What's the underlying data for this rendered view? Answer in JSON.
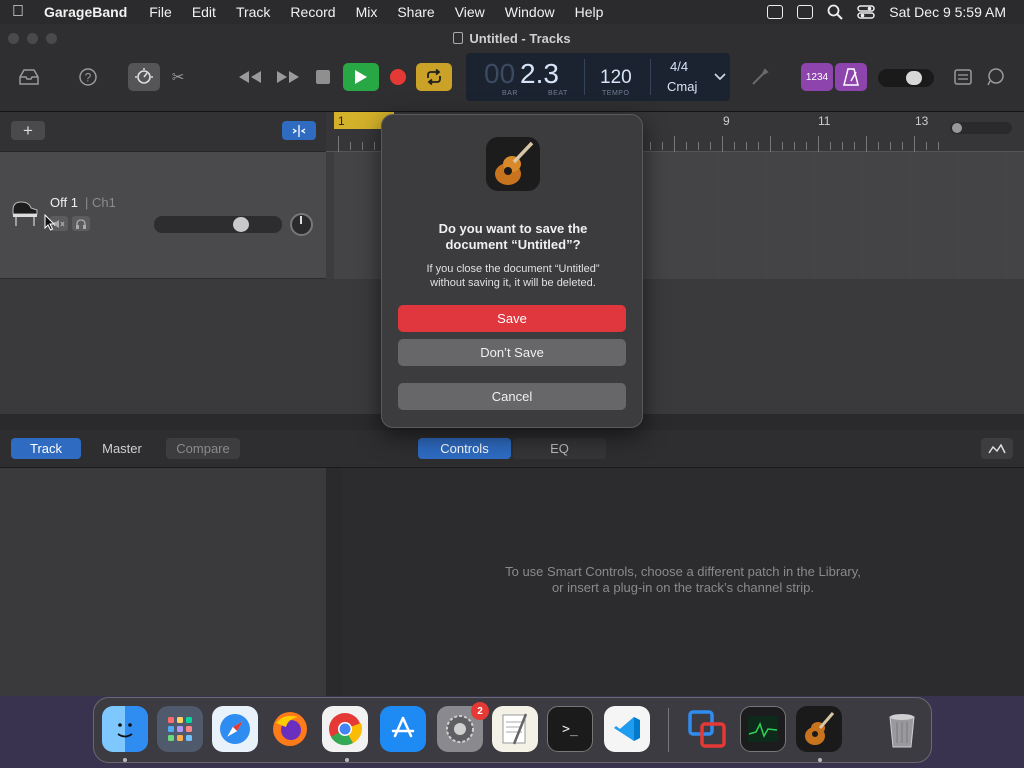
{
  "menubar": {
    "app_name": "GarageBand",
    "items": [
      "File",
      "Edit",
      "Track",
      "Record",
      "Mix",
      "Share",
      "View",
      "Window",
      "Help"
    ],
    "datetime": "Sat Dec 9  5:59 AM"
  },
  "window": {
    "title": "Untitled - Tracks"
  },
  "lcd": {
    "bar_value": "00",
    "beat_value": "2.3",
    "bar_label": "BAR",
    "beat_label": "BEAT",
    "tempo_value": "120",
    "tempo_label": "TEMPO",
    "time_signature": "4/4",
    "key": "Cmaj"
  },
  "toolbar": {
    "tuner_button": "1234"
  },
  "track": {
    "name": "Off 1",
    "channel": "| Ch1",
    "volume_level": 0.72
  },
  "ruler": {
    "marks": [
      "1",
      "9",
      "11",
      "13"
    ]
  },
  "bottom": {
    "tabs": [
      "Track",
      "Master",
      "Compare"
    ],
    "view_tabs": [
      "Controls",
      "EQ"
    ],
    "smart_controls_message_line1": "To use Smart Controls, choose a different patch in the Library,",
    "smart_controls_message_line2": "or insert a plug-in on the track’s channel strip."
  },
  "dialog": {
    "title_line1": "Do you want to save the",
    "title_line2": "document “Untitled”?",
    "message_line1": "If you close the document “Untitled”",
    "message_line2": "without saving it, it will be deleted.",
    "save_label": "Save",
    "dont_save_label": "Don’t Save",
    "cancel_label": "Cancel"
  },
  "dock": {
    "settings_badge": "2",
    "terminal_prompt": ">_"
  },
  "colors": {
    "accent_blue": "#2e6bc1",
    "play_green": "#28a745",
    "record_red": "#e53935",
    "cycle_yellow": "#c9a227",
    "purple": "#8e44ad",
    "save_button_red": "#e0363d",
    "region_yellow": "#d4b12a"
  }
}
